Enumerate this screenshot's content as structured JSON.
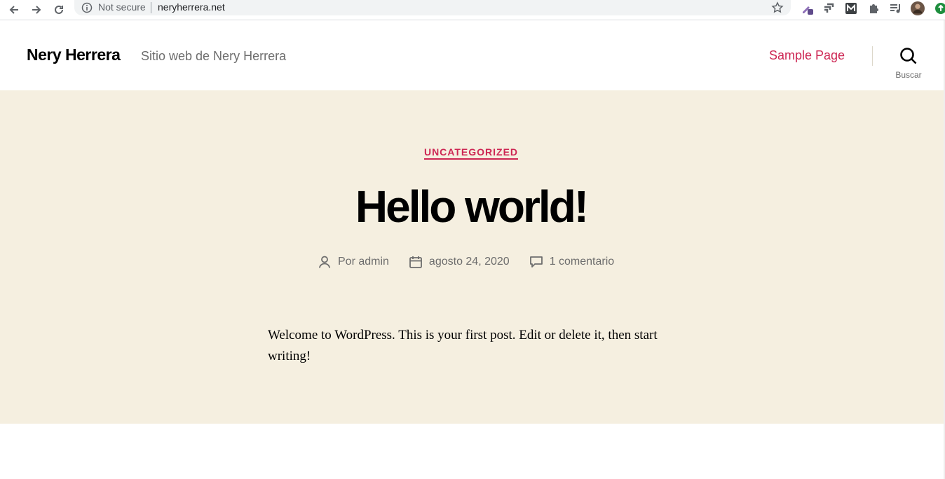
{
  "browser": {
    "security_label": "Not secure",
    "url": "neryherrera.net"
  },
  "site": {
    "title": "Nery Herrera",
    "description": "Sitio web de Nery Herrera",
    "nav_link": "Sample Page",
    "search_label": "Buscar"
  },
  "post": {
    "category": "UNCATEGORIZED",
    "title": "Hello world!",
    "author": "Por admin",
    "date": "agosto 24, 2020",
    "comments": "1 comentario",
    "body": "Welcome to WordPress. This is your first post. Edit or delete it, then start writing!"
  },
  "colors": {
    "accent": "#cd2653",
    "hero_background": "#f5efe0",
    "muted_text": "#6d6d6d"
  }
}
